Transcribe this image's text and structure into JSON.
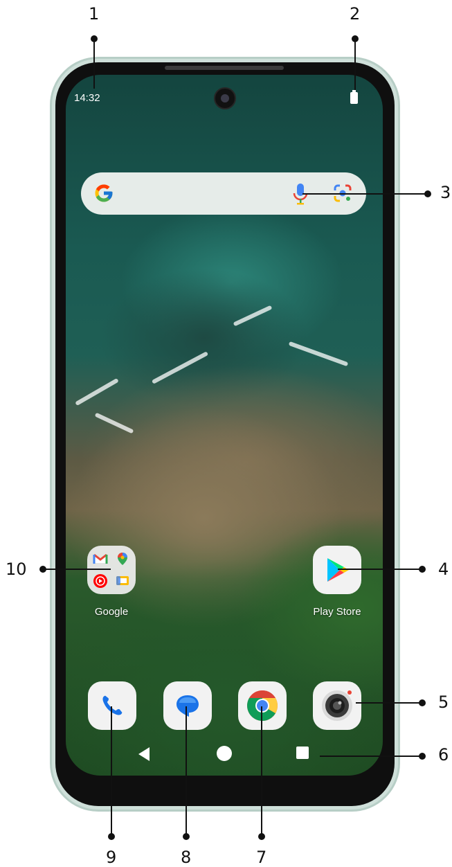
{
  "status_bar": {
    "time": "14:32"
  },
  "home": {
    "folder": {
      "label": "Google"
    },
    "play_store": {
      "label": "Play Store"
    }
  },
  "callouts": [
    "1",
    "2",
    "3",
    "4",
    "5",
    "6",
    "7",
    "8",
    "9",
    "10"
  ],
  "icons": {
    "search_logo": "google-g-icon",
    "voice": "microphone-icon",
    "lens": "google-lens-icon",
    "dock": [
      "phone-icon",
      "messages-icon",
      "chrome-icon",
      "camera-icon"
    ],
    "nav": [
      "back-icon",
      "home-icon",
      "recents-icon"
    ]
  }
}
